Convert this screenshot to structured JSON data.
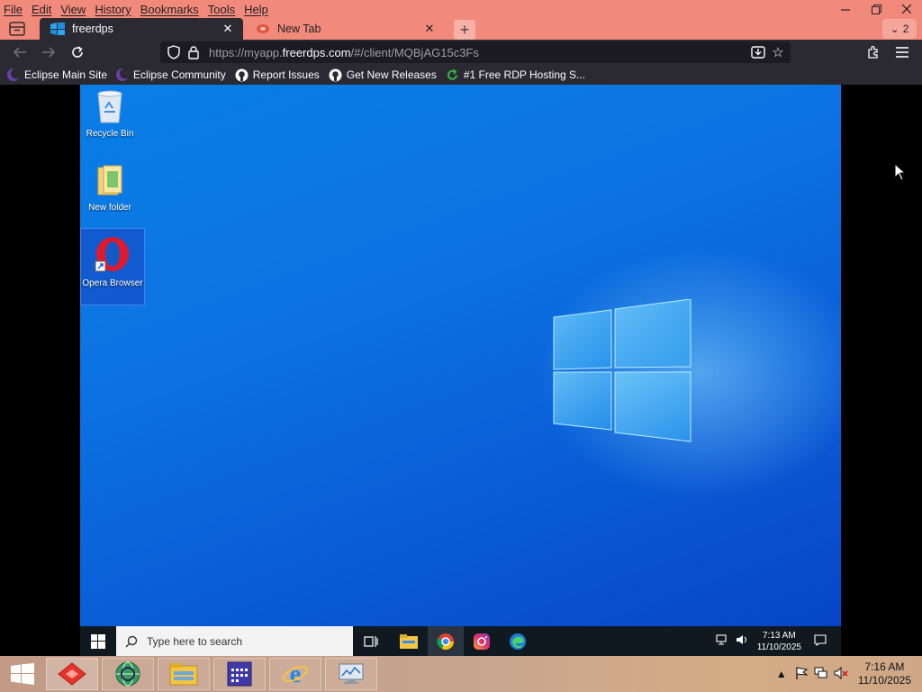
{
  "browser": {
    "menu": [
      "File",
      "Edit",
      "View",
      "History",
      "Bookmarks",
      "Tools",
      "Help"
    ],
    "tabs": [
      {
        "label": "freerdps",
        "active": true
      },
      {
        "label": "New Tab",
        "active": false
      }
    ],
    "tab_count": "2",
    "url": {
      "prefix": "https://myapp.",
      "host": "freerdps.com",
      "suffix": "/#/client/MQBjAG15c3Fs"
    },
    "bookmarks": [
      {
        "label": "Eclipse Main Site",
        "color": "#3b1f5e"
      },
      {
        "label": "Eclipse Community",
        "color": "#3b1f5e"
      },
      {
        "label": "Report Issues",
        "color": "#ffffff"
      },
      {
        "label": "Get New Releases",
        "color": "#ffffff"
      },
      {
        "label": "#1 Free RDP Hosting S...",
        "color": "#2fb64a"
      }
    ]
  },
  "remote_desktop": {
    "icons": [
      {
        "label": "Recycle Bin",
        "icon": "recycle-bin-icon"
      },
      {
        "label": "New folder",
        "icon": "folder-icon"
      },
      {
        "label": "Opera Browser",
        "icon": "opera-icon"
      }
    ],
    "taskbar": {
      "search_placeholder": "Type here to search",
      "apps": [
        "task-view-icon",
        "file-explorer-icon",
        "chrome-icon",
        "instagram-icon",
        "edge-icon"
      ],
      "time": "7:13 AM",
      "date": "11/10/2025"
    }
  },
  "local_taskbar": {
    "apps": [
      "anydesk-icon",
      "network-globe-icon",
      "file-explorer-icon",
      "calendar-app-icon",
      "internet-explorer-icon",
      "remote-desktop-icon"
    ],
    "time": "7:16 AM",
    "date": "11/10/2025"
  }
}
